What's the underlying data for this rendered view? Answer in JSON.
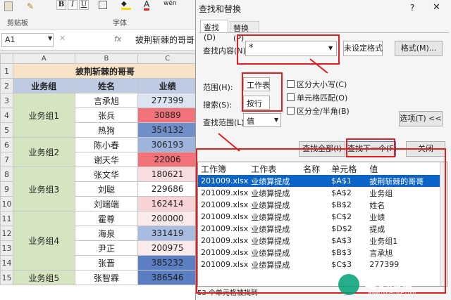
{
  "ribbon": {
    "bold": "B",
    "italic": "I",
    "underline": "U",
    "font_color_letter": "A",
    "wen": "wén",
    "clipboard": "剪贴板",
    "font": "字体"
  },
  "formula_bar": {
    "name_box": "A1",
    "formula": "披荆斩棘的哥哥"
  },
  "sheet": {
    "columns": [
      "A",
      "B",
      "C"
    ],
    "title": "披荆斩棘的哥哥",
    "headers": [
      "业务组",
      "姓名",
      "业绩"
    ],
    "row_numbers": [
      "1",
      "2",
      "3",
      "4",
      "5",
      "6",
      "7",
      "8",
      "9",
      "10",
      "11",
      "12",
      "13",
      "14",
      "15"
    ],
    "groups": [
      {
        "label": "业务组1",
        "rows": 3
      },
      {
        "label": "业务组2",
        "rows": 2
      },
      {
        "label": "业务组3",
        "rows": 3
      },
      {
        "label": "业务组4",
        "rows": 4
      },
      {
        "label": "业务组5",
        "rows": 1
      }
    ],
    "records": [
      {
        "name": "言承旭",
        "value": "277399",
        "color": "#dce3f1"
      },
      {
        "name": "张兵",
        "value": "30889",
        "color": "#f2727a"
      },
      {
        "name": "热狗",
        "value": "354132",
        "color": "#6f8fc9"
      },
      {
        "name": "陈小春",
        "value": "306193",
        "color": "#9fb4dc"
      },
      {
        "name": "谢天华",
        "value": "22006",
        "color": "#f2727a"
      },
      {
        "name": "张文华",
        "value": "180621",
        "color": "#f8dede"
      },
      {
        "name": "刘聪",
        "value": "229686",
        "color": "#ffffff"
      },
      {
        "name": "刘端端",
        "value": "162414",
        "color": "#f7d3d6"
      },
      {
        "name": "霍尊",
        "value": "200000",
        "color": "#fbeaea"
      },
      {
        "name": "海泉",
        "value": "331419",
        "color": "#a8bbe0"
      },
      {
        "name": "尹正",
        "value": "200975",
        "color": "#fbeaea"
      },
      {
        "name": "张晋",
        "value": "385232",
        "color": "#5b7fc2"
      },
      {
        "name": "张智霖",
        "value": "386546",
        "color": "#5a7ec2"
      }
    ]
  },
  "dialog": {
    "title": "查找和替换",
    "help": "?",
    "tabs": {
      "find": "查找(D)",
      "replace": "替换(P)"
    },
    "find_label": "查找内容(N):",
    "find_value": "*",
    "format_status": "未设定格式",
    "format_button": "格式(M)...",
    "within_label": "范围(H):",
    "within_value": "工作表",
    "search_label": "搜索(S):",
    "search_value": "按行",
    "lookin_label": "查找范围(L):",
    "lookin_value": "值",
    "match_case": "区分大小写(C)",
    "match_entire": "单元格匹配(O)",
    "match_byte": "区分全/半角(B)",
    "options_button": "选项(T) <<",
    "find_all": "查找全部(I)",
    "find_next": "查找下一个(F)",
    "close": "关闭",
    "results_headers": [
      "工作簿",
      "工作表",
      "名称",
      "单元格",
      "值"
    ],
    "results": [
      [
        "201009.xlsx",
        "业绩算提成",
        "",
        "$A$1",
        "披荆斩棘的哥哥"
      ],
      [
        "201009.xlsx",
        "业绩算提成",
        "",
        "$A$2",
        "业务组"
      ],
      [
        "201009.xlsx",
        "业绩算提成",
        "",
        "$B$2",
        "姓名"
      ],
      [
        "201009.xlsx",
        "业绩算提成",
        "",
        "$C$2",
        "业绩"
      ],
      [
        "201009.xlsx",
        "业绩算提成",
        "",
        "$D$2",
        "提成"
      ],
      [
        "201009.xlsx",
        "业绩算提成",
        "",
        "$A$3",
        "业务组1"
      ],
      [
        "201009.xlsx",
        "业绩算提成",
        "",
        "$B$3",
        "言承旭"
      ],
      [
        "201009.xlsx",
        "业绩算提成",
        "",
        "$C$3",
        "277399"
      ]
    ],
    "status": "53 个单元格被找到"
  },
  "watermark": {
    "text": "笔记部落",
    "suffix": ".cn",
    "url": "www.notetribe.com"
  },
  "colors": {
    "selection": "#0a64c8",
    "annotation": "#e02020"
  }
}
